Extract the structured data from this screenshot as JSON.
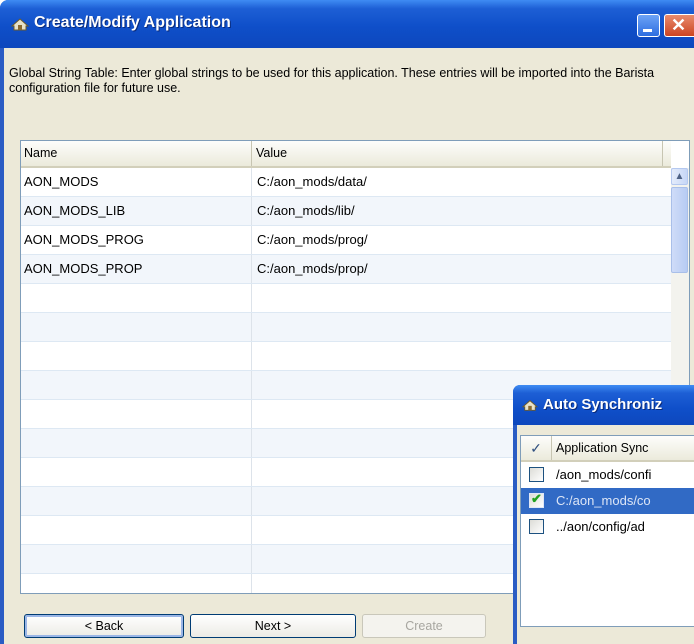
{
  "main_window": {
    "title": "Create/Modify Application",
    "description": "Global String Table: Enter global strings to be used for this application.  These entries will be imported into the Barista configuration file for future use.",
    "columns": [
      "Name",
      "Value"
    ],
    "rows": [
      {
        "name": "AON_MODS",
        "value": "C:/aon_mods/data/"
      },
      {
        "name": "AON_MODS_LIB",
        "value": "C:/aon_mods/lib/"
      },
      {
        "name": "AON_MODS_PROG",
        "value": "C:/aon_mods/prog/"
      },
      {
        "name": "AON_MODS_PROP",
        "value": "C:/aon_mods/prop/"
      }
    ],
    "buttons": {
      "back": "< Back",
      "next": "Next >",
      "create": "Create"
    }
  },
  "sync_window": {
    "title": "Auto Synchroniz",
    "header_check": "✓",
    "header_label": "Application Sync",
    "rows": [
      {
        "path": "/aon_mods/confi",
        "checked": false,
        "selected": false
      },
      {
        "path": "C:/aon_mods/co",
        "checked": true,
        "selected": true
      },
      {
        "path": "../aon/config/ad",
        "checked": false,
        "selected": false
      }
    ]
  },
  "icons": {
    "title": "app-icon",
    "minimize": "minimize-icon",
    "close": "close-icon",
    "scroll_up": "chevron-up-icon"
  },
  "colors": {
    "titlebar": "#0f4fc9",
    "dialog_bg": "#ece9d8",
    "selection": "#316ac5",
    "check": "#21a121"
  }
}
